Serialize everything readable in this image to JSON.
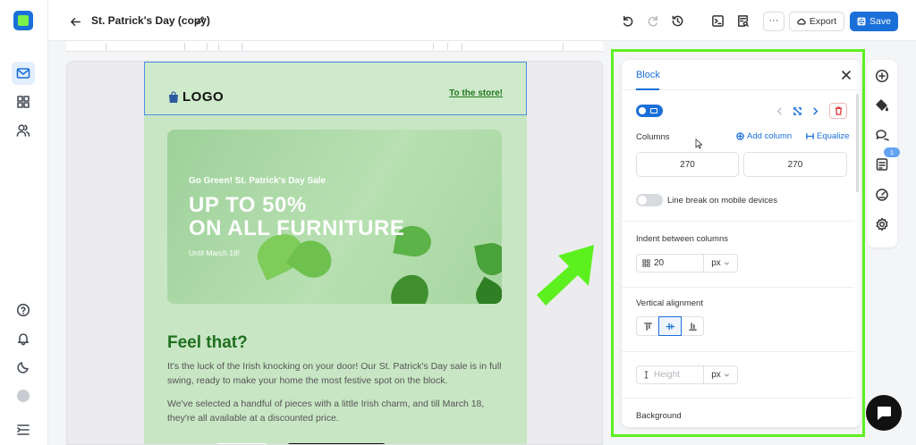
{
  "header": {
    "title": "St. Patrick's Day (copy)",
    "more_label": "···",
    "export_label": "Export",
    "save_label": "Save"
  },
  "email": {
    "logo_text": "LOGO",
    "store_link": "To the store!",
    "hero": {
      "pretitle": "Go Green! St. Patrick's Day Sale",
      "headline_line1": "UP TO 50%",
      "headline_line2": "ON ALL FURNITURE",
      "until": "Until March 18!"
    },
    "heading": "Feel that?",
    "paragraph1": "It's the luck of the Irish knocking on your door! Our St. Patrick's Day sale is in full swing, ready to make your home the most festive spot on the block.",
    "paragraph2": "We've selected a handful of pieces with a little Irish charm, and till March 18, they're all available at a discounted price."
  },
  "panel": {
    "tab_label": "Block",
    "columns_label": "Columns",
    "add_column_label": "Add column",
    "equalize_label": "Equalize",
    "column_widths": [
      "270",
      "270"
    ],
    "line_break_label": "Line break on mobile devices",
    "indent_label": "Indent between columns",
    "indent_value": "20",
    "unit_px": "px",
    "vertical_alignment_label": "Vertical alignment",
    "height_placeholder": "Height",
    "background_label": "Background"
  },
  "right_rail": {
    "badge_count": "1"
  },
  "colors": {
    "accent": "#1a6fd8",
    "highlight_frame": "#5df01f",
    "email_bg": "#c8e6c4",
    "heading_green": "#1f6f1f"
  },
  "icons": {
    "left_rail": [
      "mail-icon",
      "grid-icon",
      "users-icon",
      "help-icon",
      "bell-icon",
      "moon-icon",
      "avatar-icon",
      "collapse-icon"
    ],
    "top_bar": [
      "back-arrow-icon",
      "pencil-icon",
      "undo-icon",
      "redo-icon",
      "history-icon",
      "code-icon",
      "preview-icon"
    ],
    "right_rail": [
      "plus-circle-icon",
      "paint-bucket-icon",
      "comments-icon",
      "checklist-icon",
      "gauge-icon",
      "gear-icon"
    ]
  }
}
